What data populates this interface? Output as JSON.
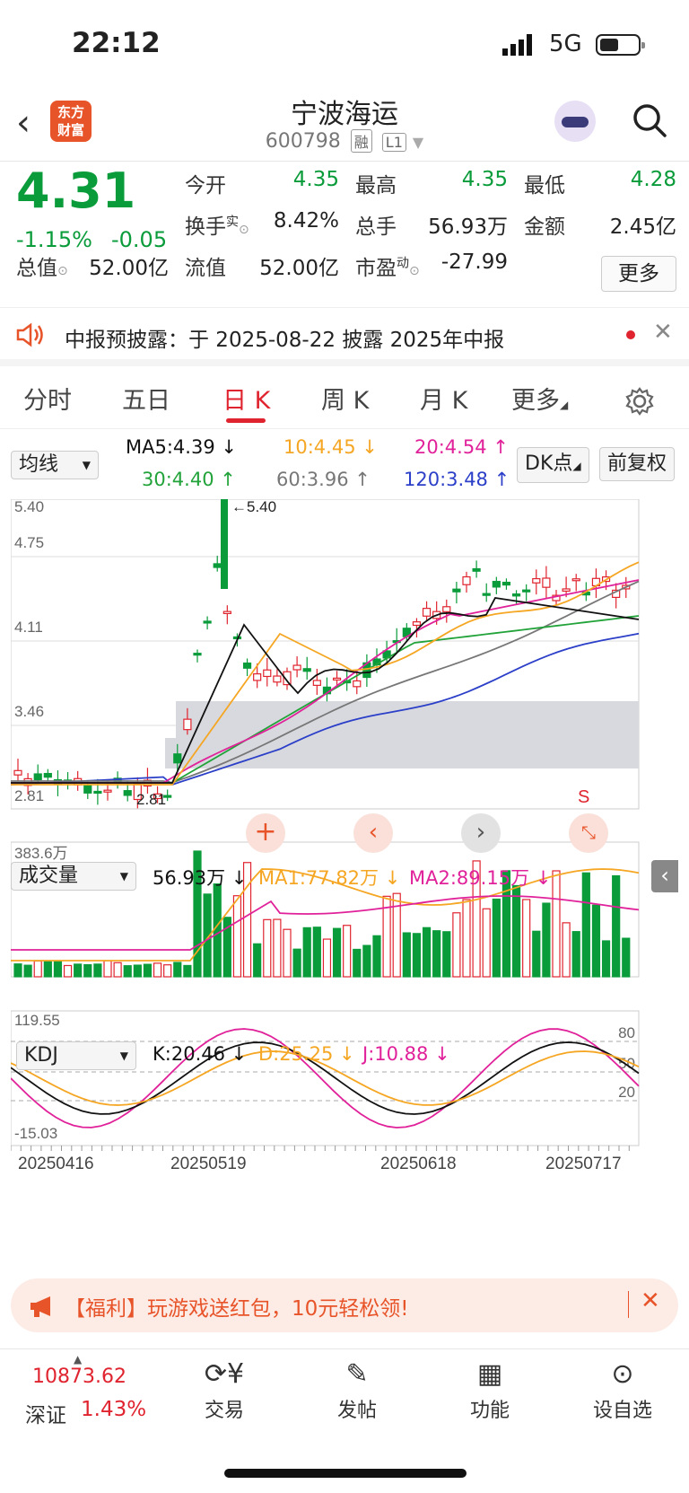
{
  "status": {
    "time": "22:12",
    "network": "5G"
  },
  "header": {
    "logo_text": "东方\n财富",
    "name": "宁波海运",
    "code": "600798",
    "badges": [
      "融",
      "L1"
    ]
  },
  "quote": {
    "price": "4.31",
    "change_pct": "-1.15%",
    "change": "-0.05",
    "fields": [
      {
        "label": "今开",
        "value": "4.35",
        "color": "green"
      },
      {
        "label": "最高",
        "value": "4.35",
        "color": "green"
      },
      {
        "label": "最低",
        "value": "4.28",
        "color": "green"
      },
      {
        "label": "换手",
        "sup": "实",
        "value": "8.42%",
        "color": "black"
      },
      {
        "label": "总手",
        "value": "56.93万",
        "color": "black"
      },
      {
        "label": "金额",
        "value": "2.45亿",
        "color": "black"
      },
      {
        "label": "总值",
        "value": "52.00亿",
        "color": "black"
      },
      {
        "label": "流值",
        "value": "52.00亿",
        "color": "black"
      },
      {
        "label": "市盈",
        "sup": "动",
        "value": "-27.99",
        "color": "black"
      }
    ],
    "more_label": "更多"
  },
  "notice": {
    "text": "中报预披露：于 2025-08-22 披露 2025年中报"
  },
  "tabs": [
    "分时",
    "五日",
    "日 K",
    "周 K",
    "月 K",
    "更多"
  ],
  "ma": {
    "selector": "均线",
    "ma5": "MA5:4.39 ↓",
    "ma10": "10:4.45 ↓",
    "ma20": "20:4.54 ↑",
    "ma30": "30:4.40 ↑",
    "ma60": "60:3.96 ↑",
    "ma120": "120:3.48 ↑",
    "dk": "DK点",
    "fq": "前复权"
  },
  "kline": {
    "y_labels": [
      "5.40",
      "4.75",
      "4.11",
      "3.46",
      "2.81"
    ],
    "high_mark": "←5.40",
    "low_mark": "2.81",
    "s_mark": "S"
  },
  "volume": {
    "selector": "成交量",
    "current": "56.93万 ↓",
    "ma1": "MA1:77.82万 ↓",
    "ma2": "MA2:89.15万 ↓",
    "max_label": "383.6万"
  },
  "kdj": {
    "selector": "KDJ",
    "k": "K:20.46 ↓",
    "d": "D:25.25 ↓",
    "j": "J:10.88 ↓",
    "top": "119.55",
    "bottom": "-15.03",
    "levels": [
      "80",
      "50",
      "20"
    ]
  },
  "dates": [
    "20250416",
    "20250519",
    "20250618",
    "20250717"
  ],
  "colors": {
    "up": "#e0242f",
    "down": "#0a9b3a",
    "ma5": "#111111",
    "ma10": "#f5a623",
    "ma20": "#e0219a",
    "ma30": "#22a33a",
    "ma60": "#777777",
    "ma120": "#2b3fc8"
  },
  "ad": {
    "text": "【福利】玩游戏送红包，10元轻松领!"
  },
  "nav": {
    "index_value": "10873.62",
    "index_name": "深证",
    "index_change": "1.43%",
    "items": [
      "交易",
      "发帖",
      "功能",
      "设自选"
    ]
  }
}
